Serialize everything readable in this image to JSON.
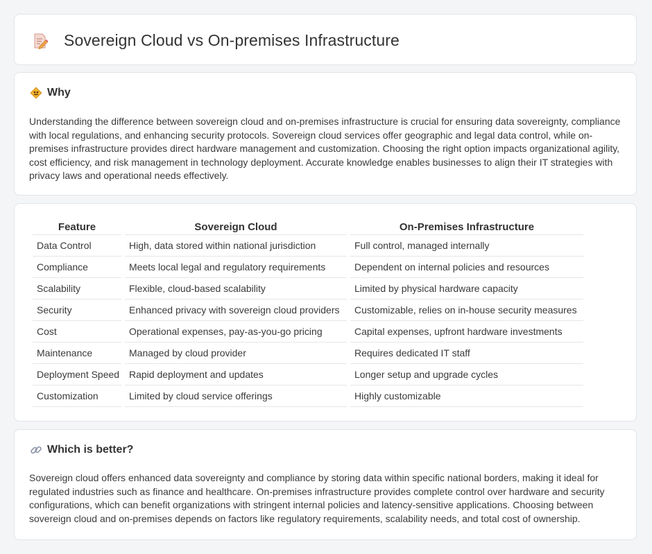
{
  "page": {
    "title": "Sovereign Cloud vs On-premises Infrastructure",
    "title_icon": "document-pencil-icon"
  },
  "why": {
    "heading": "Why",
    "icon": "diamond-sign-icon",
    "text": "Understanding the difference between sovereign cloud and on-premises infrastructure is crucial for ensuring data sovereignty, compliance with local regulations, and enhancing security protocols. Sovereign cloud services offer geographic and legal data control, while on-premises infrastructure provides direct hardware management and customization. Choosing the right option impacts organizational agility, cost efficiency, and risk management in technology deployment. Accurate knowledge enables businesses to align their IT strategies with privacy laws and operational needs effectively."
  },
  "comparison": {
    "headers": [
      "Feature",
      "Sovereign Cloud",
      "On-Premises Infrastructure"
    ],
    "rows": [
      [
        "Data Control",
        "High, data stored within national jurisdiction",
        "Full control, managed internally"
      ],
      [
        "Compliance",
        "Meets local legal and regulatory requirements",
        "Dependent on internal policies and resources"
      ],
      [
        "Scalability",
        "Flexible, cloud-based scalability",
        "Limited by physical hardware capacity"
      ],
      [
        "Security",
        "Enhanced privacy with sovereign cloud providers",
        "Customizable, relies on in-house security measures"
      ],
      [
        "Cost",
        "Operational expenses, pay-as-you-go pricing",
        "Capital expenses, upfront hardware investments"
      ],
      [
        "Maintenance",
        "Managed by cloud provider",
        "Requires dedicated IT staff"
      ],
      [
        "Deployment Speed",
        "Rapid deployment and updates",
        "Longer setup and upgrade cycles"
      ],
      [
        "Customization",
        "Limited by cloud service offerings",
        "Highly customizable"
      ]
    ]
  },
  "better": {
    "heading": "Which is better?",
    "icon": "link-icon",
    "text": "Sovereign cloud offers enhanced data sovereignty and compliance by storing data within specific national borders, making it ideal for regulated industries such as finance and healthcare. On-premises infrastructure provides complete control over hardware and security configurations, which can benefit organizations with stringent internal policies and latency-sensitive applications. Choosing between sovereign cloud and on-premises depends on factors like regulatory requirements, scalability needs, and total cost of ownership."
  }
}
